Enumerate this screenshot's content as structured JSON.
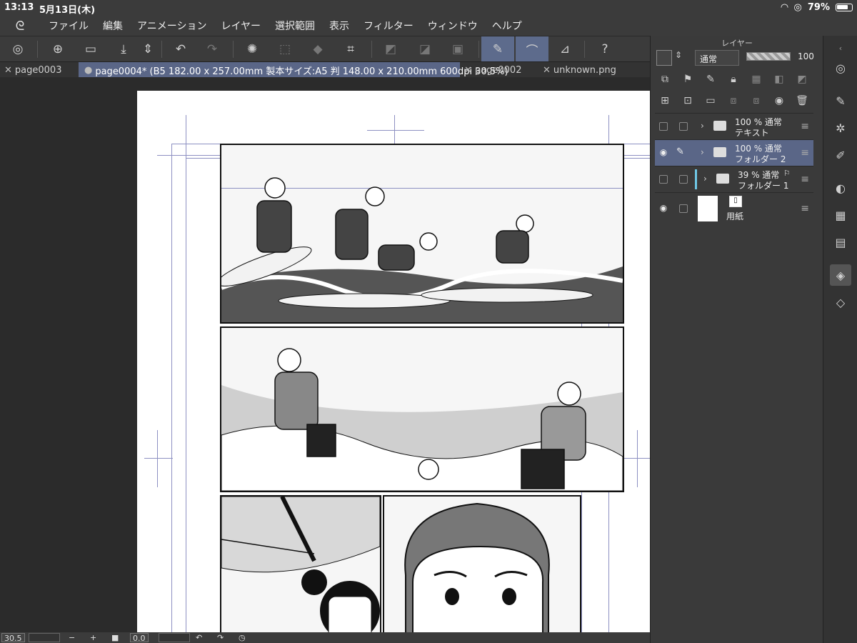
{
  "status": {
    "time": "13:13",
    "date": "5月13日(木)",
    "battery": "79%"
  },
  "menu": [
    "ファイル",
    "編集",
    "アニメーション",
    "レイヤー",
    "選択範囲",
    "表示",
    "フィルター",
    "ウィンドウ",
    "ヘルプ"
  ],
  "tabs": [
    {
      "label": "page0003",
      "active": false
    },
    {
      "label": "page0004* (B5 182.00 x 257.00mm 製本サイズ:A5 判 148.00 x 210.00mm 600dpi 30.5%)",
      "active": true
    },
    {
      "label": "page0002",
      "active": false
    },
    {
      "label": "unknown.png",
      "active": false
    }
  ],
  "layer_panel": {
    "title": "レイヤー",
    "blend_mode": "通常",
    "opacity": "100",
    "layers": [
      {
        "opacity_blend": "100 % 通常",
        "name": "テキスト",
        "visible": false,
        "selected": false
      },
      {
        "opacity_blend": "100 % 通常",
        "name": "フォルダー 2",
        "visible": true,
        "selected": true
      },
      {
        "opacity_blend": "39 % 通常",
        "name": "フォルダー 1",
        "visible": false,
        "selected": false
      },
      {
        "opacity_blend": "",
        "name": "用紙",
        "visible": true,
        "selected": false
      }
    ]
  },
  "bottom": {
    "zoom": "30.5",
    "rotation": "0.0"
  },
  "colors": {
    "accent": "#5a6687",
    "panel_bg": "#3a3a3a",
    "toolbar_bg": "#3b3b3b"
  }
}
